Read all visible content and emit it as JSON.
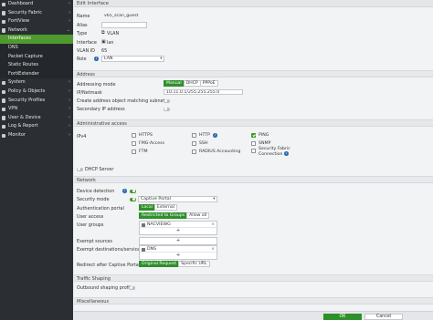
{
  "sidebar": {
    "items": [
      {
        "label": "Dashboard",
        "icon": "dashboard-icon",
        "chevron": "›"
      },
      {
        "label": "Security Fabric",
        "icon": "fabric-icon",
        "chevron": "›"
      },
      {
        "label": "FortiView",
        "icon": "fortiview-icon",
        "chevron": "›"
      },
      {
        "label": "Network",
        "icon": "network-icon",
        "chevron": "⌄"
      },
      {
        "label": "Interfaces"
      },
      {
        "label": "DNS"
      },
      {
        "label": "Packet Capture"
      },
      {
        "label": "Static Routes"
      },
      {
        "label": "FortiExtender"
      },
      {
        "label": "System",
        "icon": "system-icon",
        "chevron": "›"
      },
      {
        "label": "Policy & Objects",
        "icon": "policy-icon",
        "chevron": "›"
      },
      {
        "label": "Security Profiles",
        "icon": "shield-icon",
        "chevron": "›"
      },
      {
        "label": "VPN",
        "icon": "vpn-icon",
        "chevron": "›"
      },
      {
        "label": "User & Device",
        "icon": "user-icon",
        "chevron": "›"
      },
      {
        "label": "Log & Report",
        "icon": "log-icon",
        "chevron": "›"
      },
      {
        "label": "Monitor",
        "icon": "monitor-icon",
        "chevron": "›"
      }
    ]
  },
  "page": {
    "title": "Edit Interface"
  },
  "general": {
    "name_label": "Name",
    "name_value": "v65_scan_guest",
    "alias_label": "Alias",
    "alias_value": "",
    "type_label": "Type",
    "type_value": "VLAN",
    "interface_label": "Interface",
    "interface_value": "lan",
    "vlanid_label": "VLAN ID",
    "vlanid_value": "65",
    "role_label": "Role",
    "role_value": "LAN"
  },
  "address": {
    "header": "Address",
    "mode_label": "Addressing mode",
    "modes": [
      "Manual",
      "DHCP",
      "PPPoE"
    ],
    "ip_label": "IP/Netmask",
    "ip_value": "10.11.0.1/255.255.255.0",
    "create_label": "Create address object matching subnet",
    "secondary_label": "Secondary IP address"
  },
  "admin": {
    "header": "Administrative access",
    "ipv4_label": "IPv4",
    "https": "HTTPS",
    "fmg": "FMG-Access",
    "ftm": "FTM",
    "http": "HTTP",
    "ssh": "SSH",
    "radius": "RADIUS Accounting",
    "ping": "PING",
    "snmp": "SNMP",
    "fabric_line1": "Security Fabric",
    "fabric_line2": "Connection"
  },
  "dhcp": {
    "label": "DHCP Server"
  },
  "network": {
    "header": "Network",
    "device_detection_label": "Device detection",
    "security_mode_label": "Security mode",
    "security_mode_value": "Captive Portal",
    "auth_portal_label": "Authentication portal",
    "auth_portal_options": [
      "Local",
      "External"
    ],
    "user_access_label": "User access",
    "user_access_options": [
      "Restricted to Groups",
      "Allow all"
    ],
    "user_groups_label": "User groups",
    "user_groups_value": "NACVIEWG",
    "exempt_sources_label": "Exempt sources",
    "exempt_dest_label": "Exempt destinations/services",
    "exempt_dest_value": "DNS",
    "redirect_label": "Redirect after Captive Portal",
    "redirect_options": [
      "Original Request",
      "Specific URL"
    ],
    "plus": "+",
    "remove": "×"
  },
  "traffic": {
    "header": "Traffic Shaping",
    "outbound_label": "Outbound shaping profile"
  },
  "misc": {
    "header": "Miscellaneous"
  },
  "footer": {
    "ok": "OK",
    "cancel": "Cancel"
  },
  "colors": {
    "accent": "#2f8f2a",
    "sidebar_bg": "#2b2e33",
    "active_nav": "#4e9a2e",
    "info": "#2f6fb3"
  }
}
